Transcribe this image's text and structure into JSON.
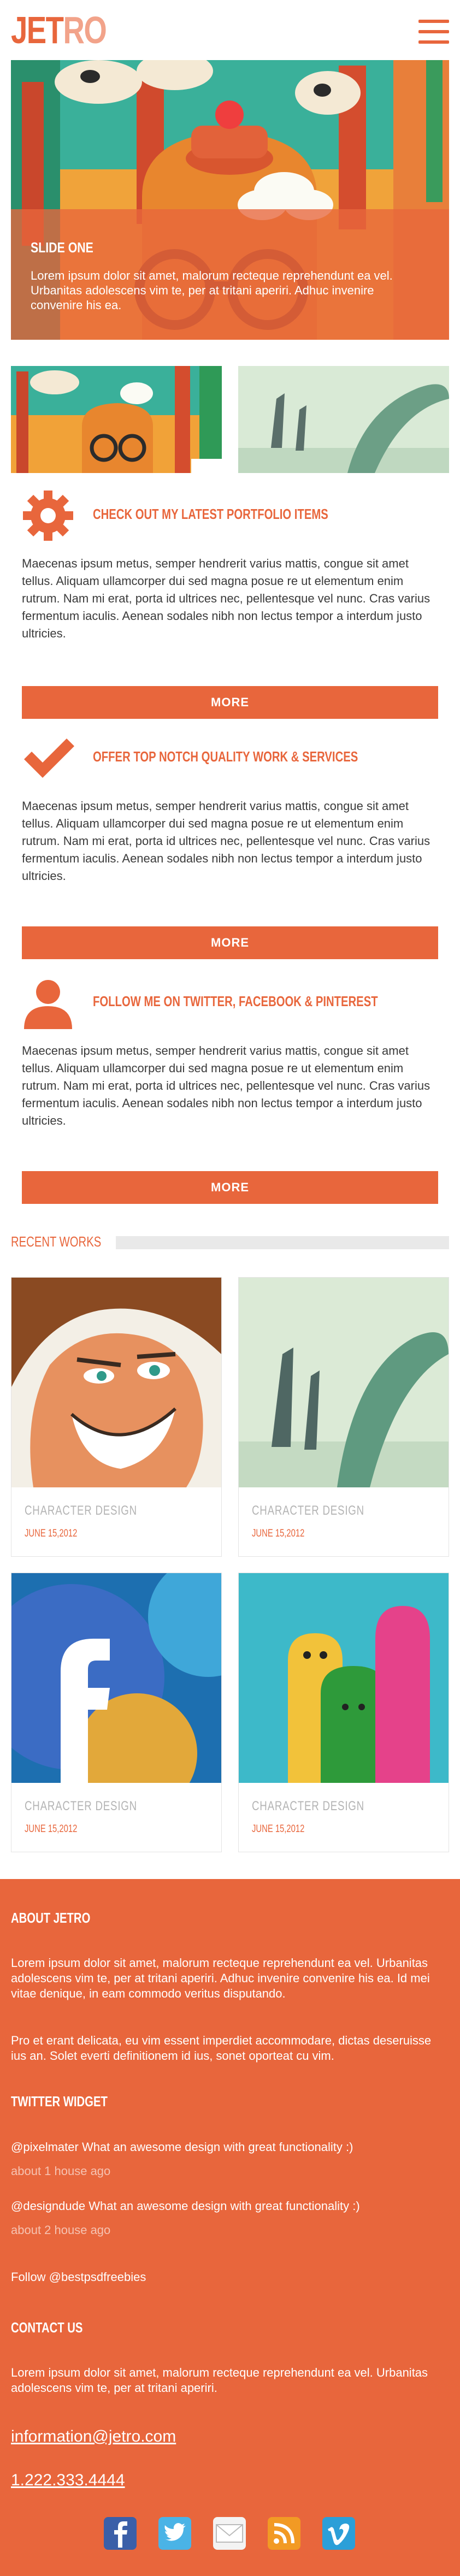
{
  "header": {
    "logo_part1": "JET",
    "logo_part2": "RO"
  },
  "slider": {
    "title": "SLIDE ONE",
    "text": "Lorem ipsum dolor sit amet, malorum recteque reprehendunt ea vel. Urbanitas adolescens vim te, per at tritani aperiri. Adhuc invenire convenire his ea."
  },
  "services": [
    {
      "title": "CHECK OUT MY LATEST PORTFOLIO ITEMS",
      "icon": "gear-icon",
      "text": "Maecenas ipsum metus, semper hendrerit varius mattis, congue sit amet tellus. Aliquam ullamcorper dui sed magna posue re ut elementum enim rutrum. Nam mi erat, porta id ultrices nec, pellentesque vel nunc. Cras varius fermentum iaculis. Aenean sodales nibh non lectus tempor a interdum justo ultricies.",
      "button": "MORE"
    },
    {
      "title": "OFFER TOP NOTCH QUALITY WORK & SERVICES",
      "icon": "checkmark-icon",
      "text": "Maecenas ipsum metus, semper hendrerit varius mattis, congue sit amet tellus. Aliquam ullamcorper dui sed magna posue re ut elementum enim rutrum. Nam mi erat, porta id ultrices nec, pellentesque vel nunc. Cras varius fermentum iaculis. Aenean sodales nibh non lectus tempor a interdum justo ultricies.",
      "button": "MORE"
    },
    {
      "title": "FOLLOW ME ON TWITTER, FACEBOOK & PINTEREST",
      "icon": "user-icon",
      "text": "Maecenas ipsum metus, semper hendrerit varius mattis, congue sit amet tellus. Aliquam ullamcorper dui sed magna posue re ut elementum enim rutrum. Nam mi erat, porta id ultrices nec, pellentesque vel nunc. Cras varius fermentum iaculis. Aenean sodales nibh non lectus tempor a interdum justo ultricies.",
      "button": "MORE"
    }
  ],
  "recent_works": {
    "title": "RECENT WORKS",
    "items": [
      {
        "title": "CHARACTER DESIGN",
        "date": "JUNE 15,2012"
      },
      {
        "title": "CHARACTER DESIGN",
        "date": "JUNE 15,2012"
      },
      {
        "title": "CHARACTER DESIGN",
        "date": "JUNE 15,2012"
      },
      {
        "title": "CHARACTER DESIGN",
        "date": "JUNE 15,2012"
      }
    ]
  },
  "footer": {
    "about_title": "ABOUT JETRO",
    "about_p1": "Lorem ipsum dolor sit amet, malorum recteque reprehendunt ea vel. Urbanitas adolescens vim te, per at tritani aperiri. Adhuc invenire convenire his ea. Id mei vitae denique, in eam commodo veritus disputando.",
    "about_p2": "Pro et erant delicata, eu vim essent imperdiet accommodare, dictas deseruisse ius an. Solet everti definitionem id ius, sonet oporteat cu vim.",
    "twitter_title": "TWITTER WIDGET",
    "tweets": [
      {
        "user": "@pixelmater",
        "text": " What an awesome design with great functionality :)",
        "time": "about 1 house ago"
      },
      {
        "user": "@designdude",
        "text": " What an awesome design with great functionality :)",
        "time": "about 2 house ago"
      }
    ],
    "follow": "Follow @bestpsdfreebies",
    "contact_title": "CONTACT US",
    "contact_text": "Lorem ipsum dolor sit amet, malorum recteque reprehendunt ea vel. Urbanitas adolescens vim te, per at tritani aperiri.",
    "email": "information@jetro.com",
    "phone": "1.222.333.4444",
    "social": [
      "facebook-icon",
      "twitter-icon",
      "mail-icon",
      "rss-icon",
      "vimeo-icon"
    ]
  },
  "colors": {
    "accent": "#e8663c",
    "light_accent": "#f2a38a",
    "grey_text": "#b4b4b4"
  }
}
